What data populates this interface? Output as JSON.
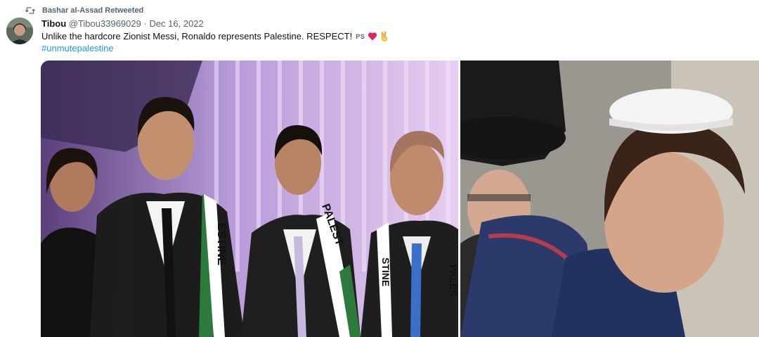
{
  "retweet": {
    "icon": "retweet-icon",
    "label": "Bashar al-Assad Retweeted"
  },
  "tweet": {
    "author_name": "Tibou",
    "handle": "@Tibou33969029",
    "separator": "·",
    "date": "Dec 16, 2022",
    "text": "Unlike the hardcore Zionist Messi, Ronaldo represents Palestine. RESPECT!",
    "flag_label": "PS",
    "emoji_heart": "❤️",
    "emoji_victory": "✌️",
    "hashtag": "#unmutepalestine"
  },
  "media": {
    "scarf_text_1": "ESTINE",
    "scarf_text_2": "PALEST",
    "scarf_text_3": "STINE",
    "scarf_text_4": "PALES"
  },
  "colors": {
    "link": "#1d9bf0",
    "secondary_text": "#536471",
    "heart": "#e0245e"
  }
}
